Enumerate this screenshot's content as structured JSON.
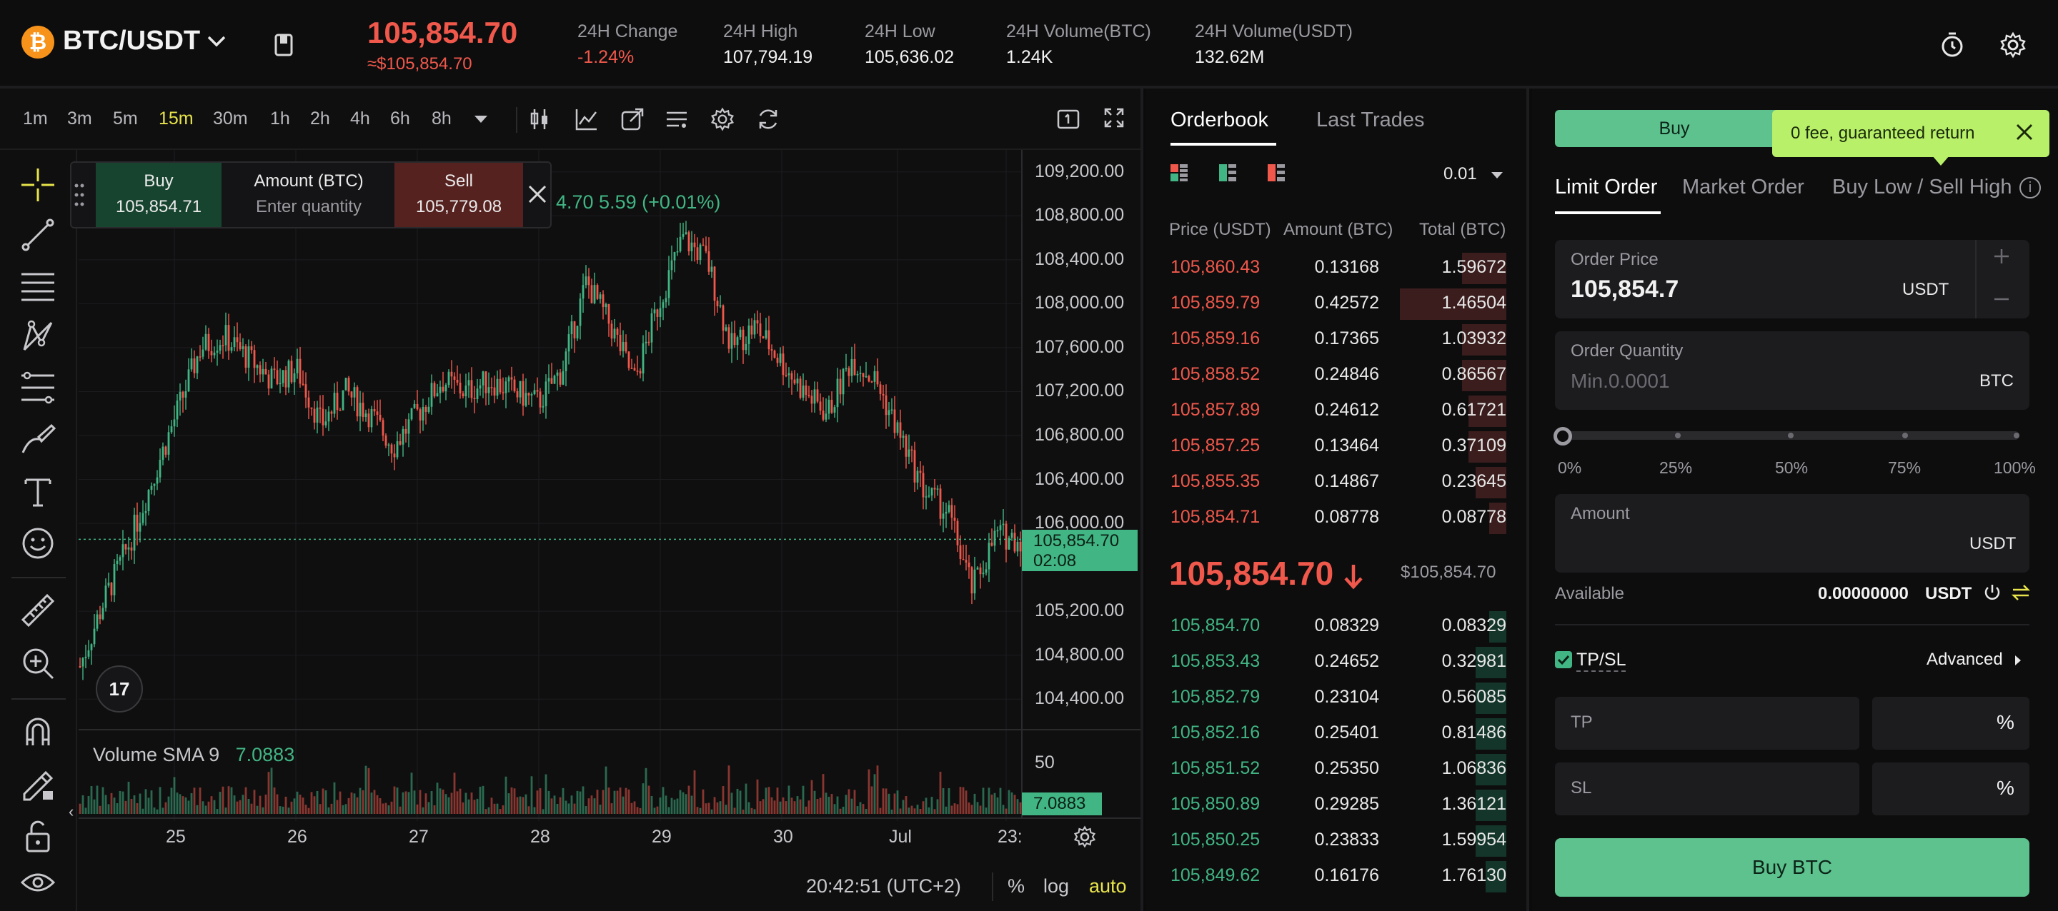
{
  "header": {
    "pair": "BTC/USDT",
    "last_price": "105,854.70",
    "last_price_fiat": "≈$105,854.70",
    "stats": [
      {
        "label": "24H Change",
        "value": "-1.24%"
      },
      {
        "label": "24H High",
        "value": "107,794.19"
      },
      {
        "label": "24H Low",
        "value": "105,636.02"
      },
      {
        "label": "24H Volume(BTC)",
        "value": "1.24K"
      },
      {
        "label": "24H Volume(USDT)",
        "value": "132.62M"
      }
    ],
    "icons": [
      "bitcoin-icon",
      "chevron-down-icon",
      "book-icon",
      "timer-icon",
      "gear-icon"
    ]
  },
  "chart": {
    "timeframes": [
      "1m",
      "3m",
      "5m",
      "15m",
      "30m",
      "1h",
      "2h",
      "4h",
      "6h",
      "8h"
    ],
    "active_timeframe": "15m",
    "quick_trade": {
      "buy_label": "Buy",
      "buy_price": "105,854.71",
      "amount_label": "Amount (BTC)",
      "amount_placeholder": "Enter quantity",
      "sell_label": "Sell",
      "sell_price": "105,779.08"
    },
    "ohlc_text": "4.70  5.59 (+0.01%)",
    "current_price_tag": "105,854.70",
    "countdown": "02:08",
    "volume_label": "Volume SMA 9",
    "volume_value": "7.0883",
    "volume_axis_label": "50",
    "footer_time": "20:42:51 (UTC+2)",
    "footer_pct": "%",
    "footer_log": "log",
    "footer_auto": "auto",
    "accent_color": "#e8e44a"
  },
  "chart_data": {
    "type": "candlestick",
    "title": "",
    "xlabel": "",
    "ylabel": "",
    "x_tick_labels": [
      "25",
      "26",
      "27",
      "28",
      "29",
      "30",
      "Jul",
      "23:"
    ],
    "y_tick_labels": [
      "109,200.00",
      "108,800.00",
      "108,400.00",
      "108,000.00",
      "107,600.00",
      "107,200.00",
      "106,800.00",
      "106,400.00",
      "106,000.00",
      "105,200.00",
      "104,800.00",
      "104,400.00"
    ],
    "ylim": [
      104200,
      109400
    ],
    "close_path": [
      104700,
      105300,
      105800,
      106400,
      107000,
      107600,
      107700,
      107500,
      107300,
      107400,
      106900,
      107200,
      107000,
      106700,
      107000,
      107300,
      107200,
      107300,
      107200,
      107100,
      107400,
      108200,
      107800,
      107300,
      108000,
      108600,
      108400,
      107600,
      107800,
      107500,
      107200,
      107000,
      107500,
      107300,
      106800,
      106300,
      106100,
      105400,
      105900,
      105854.7
    ],
    "up_color": "#41b583",
    "down_color": "#f0584b"
  },
  "orderbook": {
    "tabs": [
      "Orderbook",
      "Last Trades"
    ],
    "precision": "0.01",
    "headers": [
      "Price (USDT)",
      "Amount (BTC)",
      "Total (BTC)"
    ],
    "asks": [
      {
        "price": "105,860.43",
        "amount": "0.13168",
        "total": "1.59672",
        "depth": 0.13
      },
      {
        "price": "105,859.79",
        "amount": "0.42572",
        "total": "1.46504",
        "depth": 0.31
      },
      {
        "price": "105,859.16",
        "amount": "0.17365",
        "total": "1.03932",
        "depth": 0.13
      },
      {
        "price": "105,858.52",
        "amount": "0.24846",
        "total": "0.86567",
        "depth": 0.13
      },
      {
        "price": "105,857.89",
        "amount": "0.24612",
        "total": "0.61721",
        "depth": 0.11
      },
      {
        "price": "105,857.25",
        "amount": "0.13464",
        "total": "0.37109",
        "depth": 0.11
      },
      {
        "price": "105,855.35",
        "amount": "0.14867",
        "total": "0.23645",
        "depth": 0.09
      },
      {
        "price": "105,854.71",
        "amount": "0.08778",
        "total": "0.08778",
        "depth": 0.05
      }
    ],
    "mid_price": "105,854.70",
    "mid_fiat": "$105,854.70",
    "bids": [
      {
        "price": "105,854.70",
        "amount": "0.08329",
        "total": "0.08329",
        "depth": 0.05
      },
      {
        "price": "105,853.43",
        "amount": "0.24652",
        "total": "0.32981",
        "depth": 0.09
      },
      {
        "price": "105,852.79",
        "amount": "0.23104",
        "total": "0.56085",
        "depth": 0.09
      },
      {
        "price": "105,852.16",
        "amount": "0.25401",
        "total": "0.81486",
        "depth": 0.09
      },
      {
        "price": "105,851.52",
        "amount": "0.25350",
        "total": "1.06836",
        "depth": 0.09
      },
      {
        "price": "105,850.89",
        "amount": "0.29285",
        "total": "1.36121",
        "depth": 0.09
      },
      {
        "price": "105,850.25",
        "amount": "0.23833",
        "total": "1.59954",
        "depth": 0.09
      },
      {
        "price": "105,849.62",
        "amount": "0.16176",
        "total": "1.76130",
        "depth": 0.06
      }
    ]
  },
  "order_form": {
    "buy_label": "Buy",
    "toast": "0 fee, guaranteed return",
    "order_types": [
      "Limit Order",
      "Market Order",
      "Buy Low / Sell High"
    ],
    "price_label": "Order Price",
    "price_value": "105,854.7",
    "price_unit": "USDT",
    "qty_label": "Order Quantity",
    "qty_placeholder": "Min.0.0001",
    "qty_unit": "BTC",
    "slider_marks": [
      "0%",
      "25%",
      "50%",
      "75%",
      "100%"
    ],
    "slider_value": 0,
    "amount_label": "Amount",
    "amount_unit": "USDT",
    "available_label": "Available",
    "available_value": "0.00000000",
    "available_unit": "USDT",
    "tpsl_label": "TP/SL",
    "advanced_label": "Advanced",
    "tp_label": "TP",
    "sl_label": "SL",
    "pct_symbol": "%",
    "submit_label": "Buy BTC"
  }
}
